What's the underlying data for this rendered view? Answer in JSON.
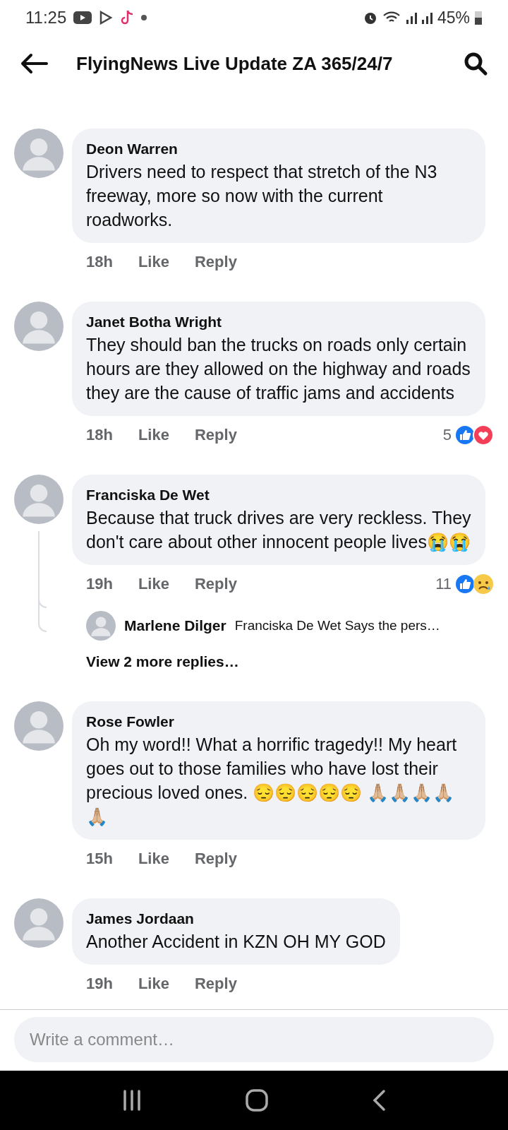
{
  "status_bar": {
    "time": "11:25",
    "battery": "45%"
  },
  "header": {
    "title": "FlyingNews Live Update ZA 365/24/7"
  },
  "comments": [
    {
      "author": "Deon Warren",
      "text": "Drivers need to respect that stretch of the N3 freeway, more so now with the current roadworks.",
      "time": "18h",
      "like_label": "Like",
      "reply_label": "Reply"
    },
    {
      "author": "Janet Botha Wright",
      "text": "They should ban the trucks on roads only certain hours are they allowed on the highway and roads they are the cause of traffic jams and accidents",
      "time": "18h",
      "like_label": "Like",
      "reply_label": "Reply",
      "reactions": {
        "count": "5",
        "icons": [
          {
            "kind": "like"
          },
          {
            "kind": "love"
          }
        ]
      }
    },
    {
      "author": "Franciska De Wet",
      "text": "Because that truck drives are very reckless. They don't care about other innocent people lives😭😭",
      "time": "19h",
      "like_label": "Like",
      "reply_label": "Reply",
      "reactions": {
        "count": "11",
        "icons": [
          {
            "kind": "like"
          },
          {
            "kind": "sad"
          }
        ]
      },
      "replies": {
        "preview": [
          {
            "author": "Marlene Dilger",
            "text": "Franciska De Wet Says the pers…"
          }
        ],
        "more_label": "View 2 more replies…"
      }
    },
    {
      "author": "Rose Fowler",
      "text": "Oh my word!! What a horrific tragedy!! My heart goes out to those families who have lost their precious loved ones. 😔😔😔😔😔 🙏🏼🙏🏼🙏🏼🙏🏼🙏🏼",
      "time": "15h",
      "like_label": "Like",
      "reply_label": "Reply"
    },
    {
      "author": "James Jordaan",
      "text": "Another Accident in KZN OH MY GOD",
      "time": "19h",
      "like_label": "Like",
      "reply_label": "Reply"
    }
  ],
  "composer": {
    "placeholder": "Write a comment…"
  }
}
